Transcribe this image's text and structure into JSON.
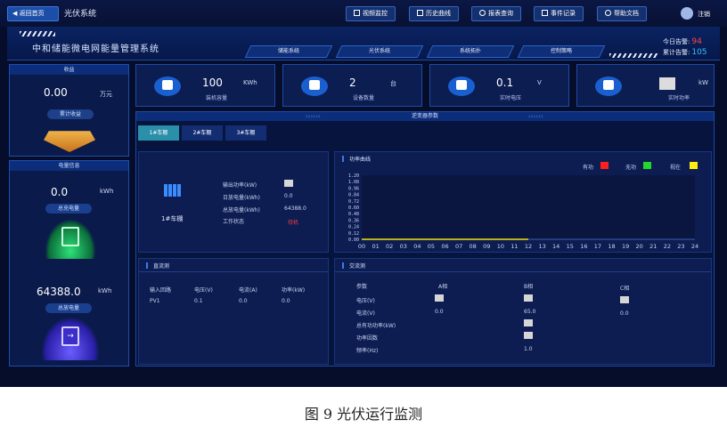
{
  "topbar": {
    "back_label": "返回首页",
    "system_name": "光伏系统",
    "nav": [
      "视频监控",
      "历史曲线",
      "报表查询",
      "事件记录",
      "帮助文档"
    ],
    "user": "注销"
  },
  "header": {
    "title": "中和储能微电网能量管理系统",
    "tabs": [
      "储能系统",
      "光伏系统",
      "系统拓扑",
      "控制策略"
    ],
    "alarm_today_label": "今日告警:",
    "alarm_today_value": "94",
    "alarm_total_label": "累计告警:",
    "alarm_total_value": "105"
  },
  "left": {
    "income_title": "收益",
    "income_value": "0.00",
    "income_unit": "万元",
    "income_badge": "累计收益",
    "energy_title": "电量信息",
    "charge_value": "0.0",
    "charge_unit": "kWh",
    "charge_badge": "总充电量",
    "discharge_value": "64388.0",
    "discharge_unit": "kWh",
    "discharge_badge": "总放电量"
  },
  "stats": [
    {
      "value": "100",
      "unit": "KWh",
      "label": "装机容量"
    },
    {
      "value": "2",
      "unit": "台",
      "label": "设备数量"
    },
    {
      "value": "0.1",
      "unit": "V",
      "label": "实时电压"
    },
    {
      "value": "",
      "unit": "kW",
      "label": "实时功率"
    }
  ],
  "main": {
    "title": "逆变器参数",
    "subtabs": [
      "1#车棚",
      "2#车棚",
      "3#车棚"
    ],
    "device_name": "1#车棚",
    "fields": [
      {
        "label": "输出功率(kW)",
        "value": ""
      },
      {
        "label": "日放电量(kWh)",
        "value": "0.0"
      },
      {
        "label": "总放电量(kWh)",
        "value": "64388.0"
      },
      {
        "label": "工作状态",
        "value": "待机"
      }
    ],
    "chart_title": "功率曲线",
    "legend": [
      {
        "name": "有功",
        "color": "#ff1f1f"
      },
      {
        "name": "无功",
        "color": "#22d82a"
      },
      {
        "name": "视在",
        "color": "#ffee10"
      }
    ],
    "dc_title": "直流测",
    "dc_headers": [
      "输入回路",
      "电压(V)",
      "电流(A)",
      "功率(kW)"
    ],
    "dc_rows": [
      [
        "PV1",
        "0.1",
        "0.0",
        "0.0"
      ]
    ],
    "ac_title": "交流测",
    "ac_headers": [
      "参数",
      "A相",
      "B相",
      "C相"
    ],
    "ac_rows": [
      [
        "电压(V)",
        "",
        "",
        ""
      ],
      [
        "电流(V)",
        "0.0",
        "65.0",
        "0.0"
      ],
      [
        "总有功功率(kW)",
        "",
        "",
        ""
      ],
      [
        "功率因数",
        "",
        "",
        ""
      ],
      [
        "频率(Hz)",
        "",
        "1.0",
        ""
      ]
    ]
  },
  "caption": "图 9  光伏运行监测",
  "chart_data": {
    "type": "line",
    "title": "功率曲线",
    "x": [
      "00",
      "01",
      "02",
      "03",
      "04",
      "05",
      "06",
      "07",
      "08",
      "09",
      "10",
      "11",
      "12",
      "13",
      "14",
      "15",
      "16",
      "17",
      "18",
      "19",
      "20",
      "21",
      "22",
      "23",
      "24"
    ],
    "yticks": [
      "1.20",
      "1.08",
      "0.96",
      "0.84",
      "0.72",
      "0.60",
      "0.48",
      "0.36",
      "0.24",
      "0.12",
      "0.00"
    ],
    "ylim": [
      0,
      1.2
    ],
    "series": [
      {
        "name": "有功",
        "color": "#ff1f1f",
        "values": [
          0,
          0,
          0,
          0,
          0,
          0,
          0,
          0,
          0,
          0,
          0,
          0,
          0
        ]
      },
      {
        "name": "无功",
        "color": "#22d82a",
        "values": [
          0,
          0,
          0,
          0,
          0,
          0,
          0,
          0,
          0,
          0,
          0,
          0,
          0
        ]
      },
      {
        "name": "视在",
        "color": "#ffee10",
        "values": [
          0,
          0,
          0,
          0,
          0,
          0,
          0,
          0,
          0,
          0,
          0,
          0,
          0
        ]
      }
    ]
  }
}
